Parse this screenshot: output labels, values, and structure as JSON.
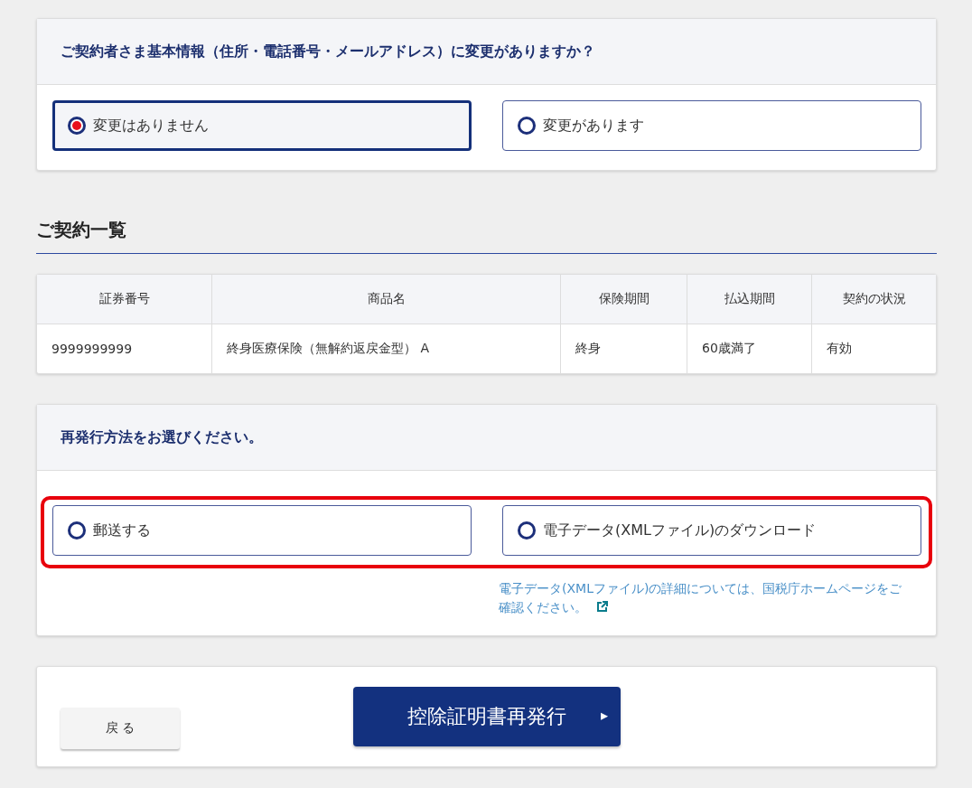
{
  "change_question": {
    "title": "ご契約者さま基本情報（住所・電話番号・メールアドレス）に変更がありますか？",
    "options": [
      {
        "label": "変更はありません",
        "selected": true
      },
      {
        "label": "変更があります",
        "selected": false
      }
    ]
  },
  "contracts": {
    "heading": "ご契約一覧",
    "columns": [
      "証券番号",
      "商品名",
      "保険期間",
      "払込期間",
      "契約の状況"
    ],
    "rows": [
      [
        "9999999999",
        "終身医療保険（無解約返戻金型） A",
        "終身",
        "60歳満了",
        "有効"
      ]
    ]
  },
  "reissue_method": {
    "title": "再発行方法をお選びください。",
    "highlighted": true,
    "options": [
      {
        "label": "郵送する",
        "selected": false
      },
      {
        "label": "電子データ(XMLファイル)のダウンロード",
        "selected": false
      }
    ],
    "note_link": "電子データ(XMLファイル)の詳細については、国税庁ホームページをご確認ください。"
  },
  "actions": {
    "back": "戻 る",
    "submit": "控除証明書再発行",
    "submit_arrow": "▸"
  }
}
